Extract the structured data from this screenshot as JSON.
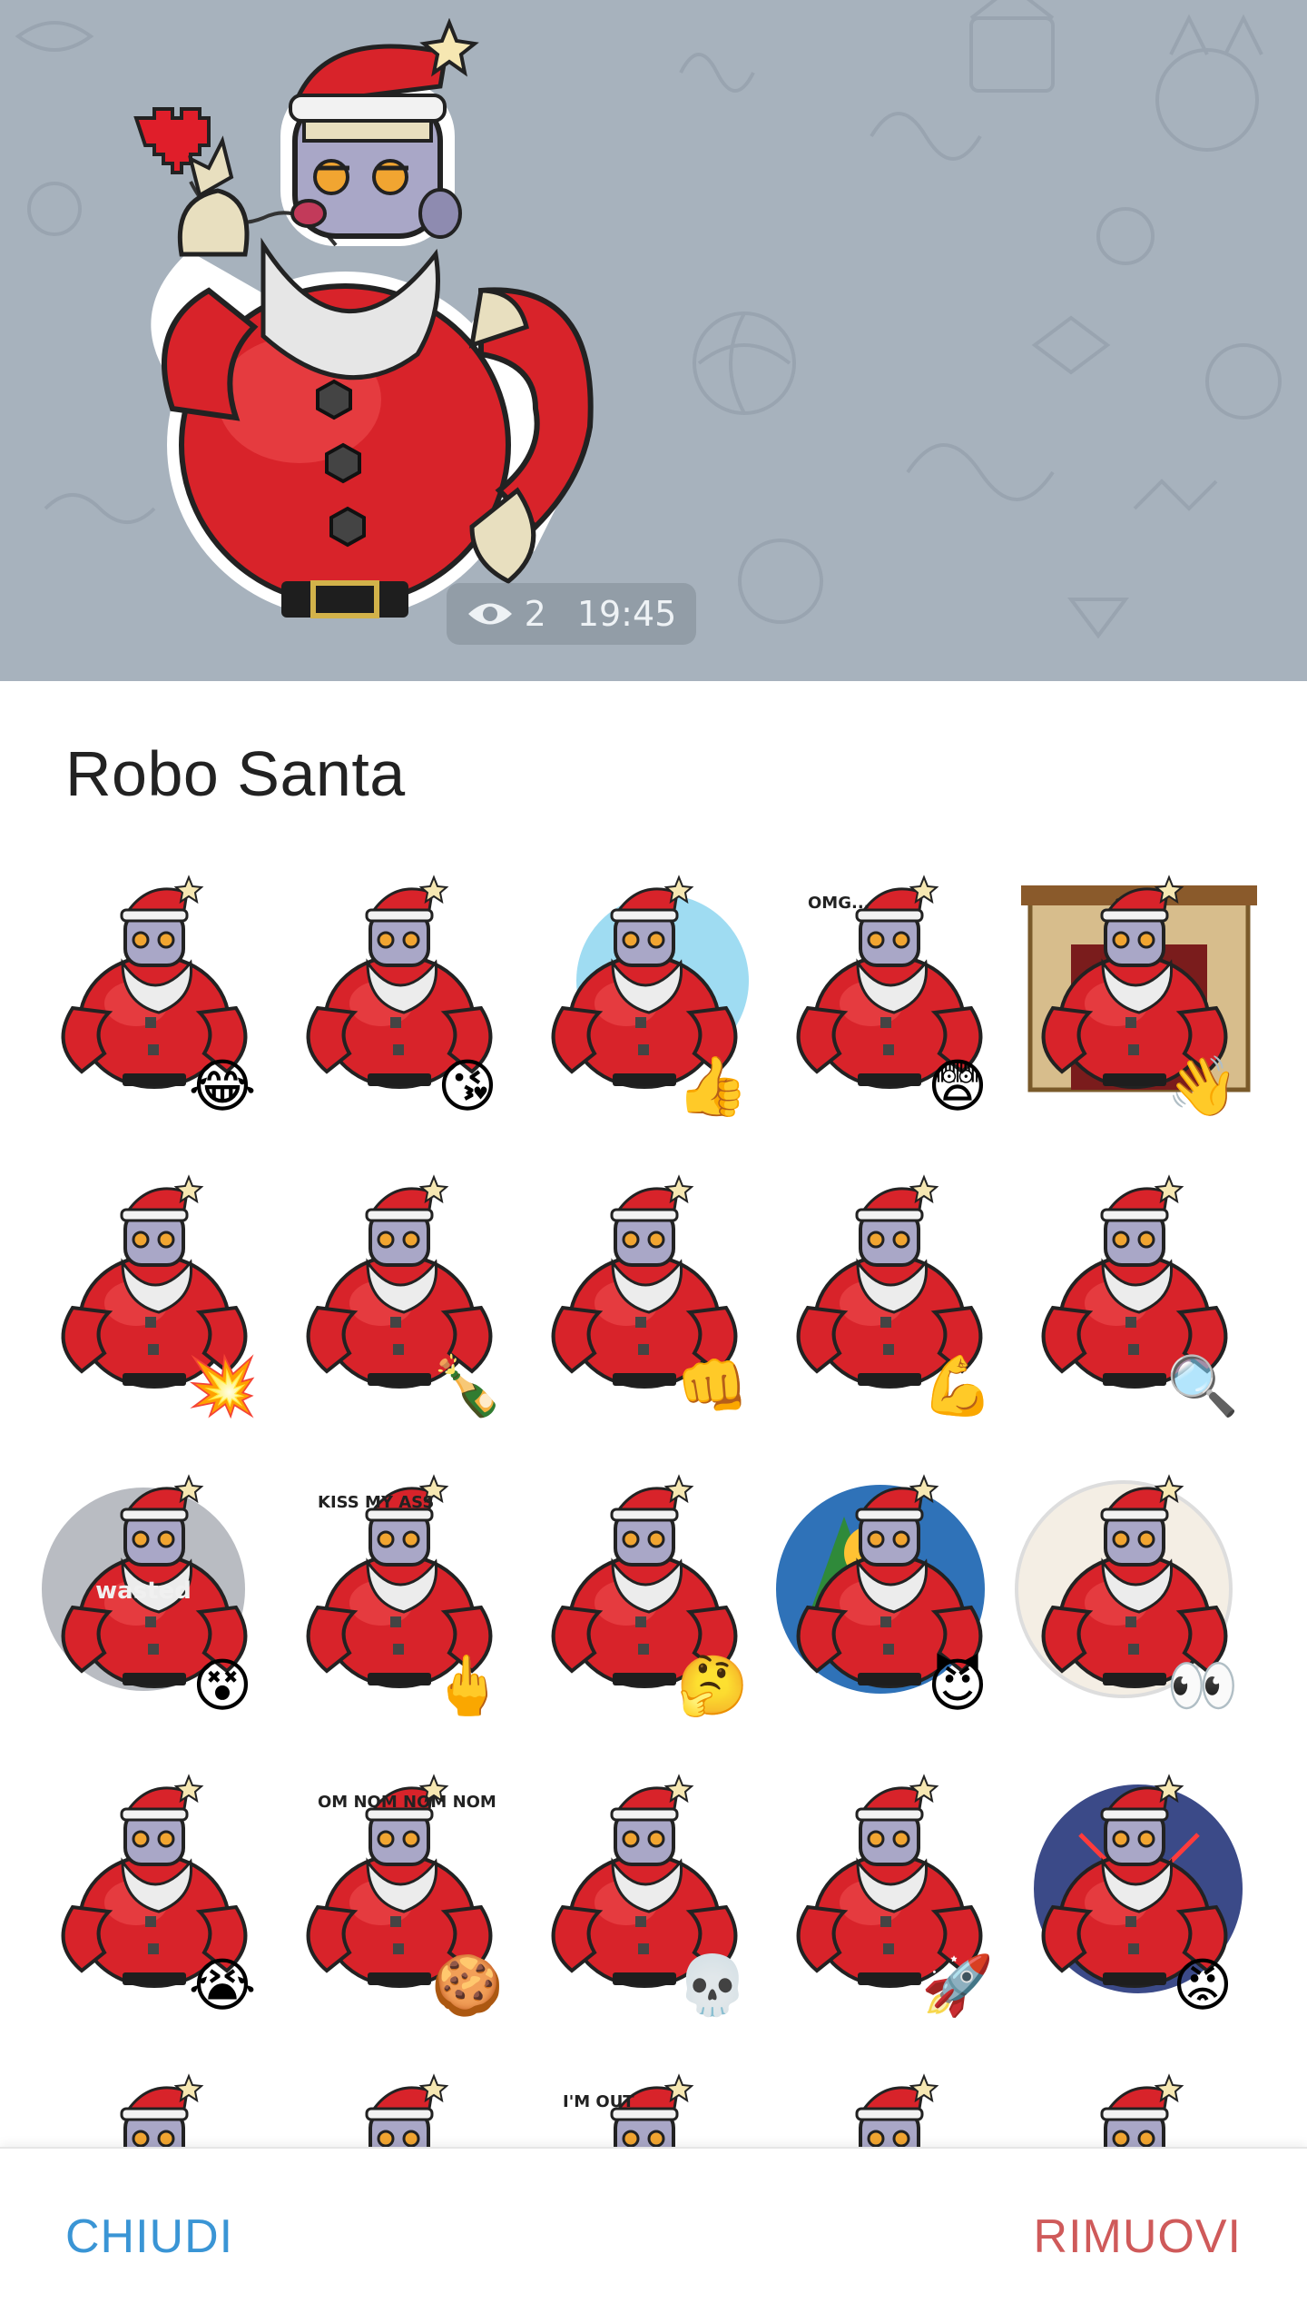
{
  "message": {
    "views": "2",
    "time": "19:45"
  },
  "sheet": {
    "title": "Robo Santa",
    "close_label": "CHIUDI",
    "remove_label": "RIMUOVI"
  },
  "stickers": [
    {
      "name": "laughing",
      "emoji": "😂",
      "text": ""
    },
    {
      "name": "kiss",
      "emoji": "😘",
      "text": ""
    },
    {
      "name": "thumbs-up",
      "emoji": "👍",
      "text": ""
    },
    {
      "name": "fearful",
      "emoji": "😨",
      "text": "OMG..."
    },
    {
      "name": "waving-fireplace",
      "emoji": "👋",
      "text": ""
    },
    {
      "name": "explosion",
      "emoji": "💥",
      "text": ""
    },
    {
      "name": "drunk",
      "emoji": "🍾",
      "text": ""
    },
    {
      "name": "punch",
      "emoji": "👊",
      "text": ""
    },
    {
      "name": "muscle-pump",
      "emoji": "💪",
      "text": ""
    },
    {
      "name": "binoculars",
      "emoji": "🔍",
      "text": ""
    },
    {
      "name": "wasted",
      "emoji": "😵",
      "text": "wasted"
    },
    {
      "name": "kiss-my-ass",
      "emoji": "🖕",
      "text": "KISS MY ASS"
    },
    {
      "name": "thinking",
      "emoji": "🤔",
      "text": ""
    },
    {
      "name": "devil-tree-fire",
      "emoji": "😈",
      "text": ""
    },
    {
      "name": "peeking",
      "emoji": "👀",
      "text": ""
    },
    {
      "name": "crying-puddle",
      "emoji": "😭",
      "text": ""
    },
    {
      "name": "cookies",
      "emoji": "🍪",
      "text": "OM NOM NOM NOM"
    },
    {
      "name": "skull-sword",
      "emoji": "💀",
      "text": ""
    },
    {
      "name": "rocket",
      "emoji": "🚀",
      "text": ""
    },
    {
      "name": "angry-lasers",
      "emoji": "😡",
      "text": ""
    },
    {
      "name": "partial-1",
      "emoji": "",
      "text": ""
    },
    {
      "name": "partial-2",
      "emoji": "",
      "text": ""
    },
    {
      "name": "partial-3",
      "emoji": "",
      "text": "I'M OUT"
    },
    {
      "name": "partial-4",
      "emoji": "",
      "text": ""
    },
    {
      "name": "partial-5",
      "emoji": "",
      "text": ""
    }
  ],
  "colors": {
    "chat_bg": "#a7b2bd",
    "santa_red": "#d8232a",
    "close_blue": "#3a95d5",
    "remove_red": "#cf5a5a"
  }
}
